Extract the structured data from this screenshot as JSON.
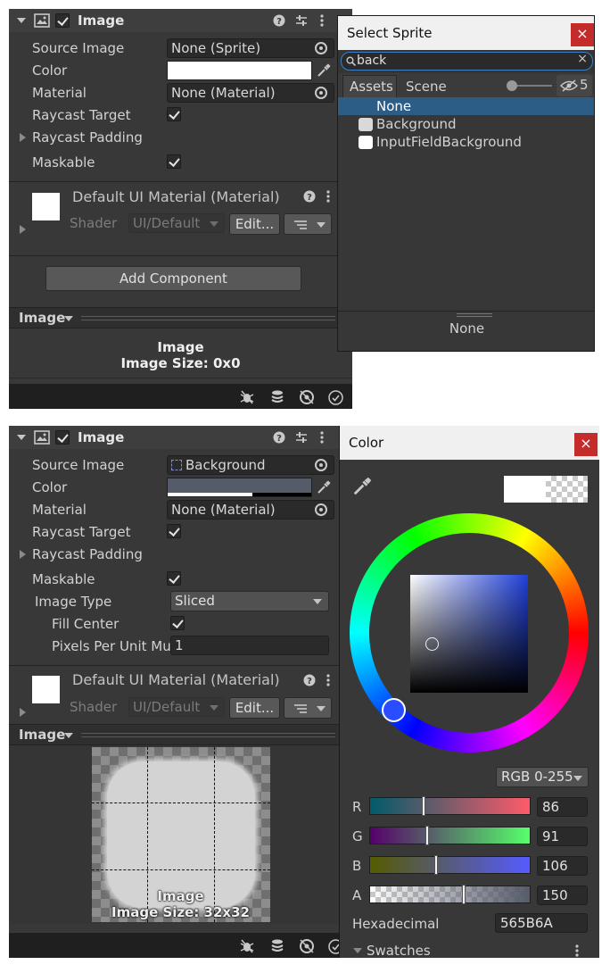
{
  "colors": {
    "panel_bg": "#383838",
    "header_bg": "#3e3e3e",
    "selection": "#2c5d87",
    "close_red": "#c42b2b",
    "picked_color": "#565B6A"
  },
  "icons": [
    "image-component-icon",
    "help-icon",
    "preset-icon",
    "more-icon",
    "picker-dot-icon",
    "eyedropper-icon",
    "search-icon",
    "clear-icon",
    "eye-hidden-icon",
    "sprite-icon",
    "debug-icon",
    "layers-icon",
    "gizmo-icon",
    "check-circle-icon"
  ],
  "top": {
    "inspector": {
      "component_title": "Image",
      "source_image_label": "Source Image",
      "source_image_value": "None (Sprite)",
      "color_label": "Color",
      "material_label": "Material",
      "material_value": "None (Material)",
      "raycast_target_label": "Raycast Target",
      "raycast_padding_label": "Raycast Padding",
      "maskable_label": "Maskable",
      "material_asset_title": "Default UI Material (Material)",
      "shader_label": "Shader",
      "shader_value": "UI/Default",
      "edit_button": "Edit...",
      "add_component": "Add Component",
      "preview_dropdown": "Image",
      "preview_title": "Image",
      "preview_size": "Image Size: 0x0"
    },
    "sprite_window": {
      "title": "Select Sprite",
      "close": "×",
      "search_value": "back",
      "tab_assets": "Assets",
      "tab_scene": "Scene",
      "hidden_count": "5",
      "items": [
        "None",
        "Background",
        "InputFieldBackground"
      ],
      "footer": "None"
    }
  },
  "bottom": {
    "inspector": {
      "component_title": "Image",
      "source_image_label": "Source Image",
      "source_image_value": "Background",
      "color_label": "Color",
      "material_label": "Material",
      "material_value": "None (Material)",
      "raycast_target_label": "Raycast Target",
      "raycast_padding_label": "Raycast Padding",
      "maskable_label": "Maskable",
      "image_type_label": "Image Type",
      "image_type_value": "Sliced",
      "fill_center_label": "Fill Center",
      "ppu_label": "Pixels Per Unit Mu",
      "ppu_value": "1",
      "material_asset_title": "Default UI Material (Material)",
      "shader_label": "Shader",
      "shader_value": "UI/Default",
      "edit_button": "Edit...",
      "preview_dropdown": "Image",
      "preview_title": "Image",
      "preview_size": "Image Size: 32x32"
    },
    "color_window": {
      "title": "Color",
      "close": "×",
      "mode": "RGB 0-255",
      "r_label": "R",
      "r_value": "86",
      "r_fraction": 0.337,
      "g_label": "G",
      "g_value": "91",
      "g_fraction": 0.357,
      "b_label": "B",
      "b_value": "106",
      "b_fraction": 0.416,
      "a_label": "A",
      "a_value": "150",
      "a_fraction": 0.588,
      "hex_label": "Hexadecimal",
      "hex_value": "565B6A",
      "swatches_label": "Swatches"
    }
  }
}
